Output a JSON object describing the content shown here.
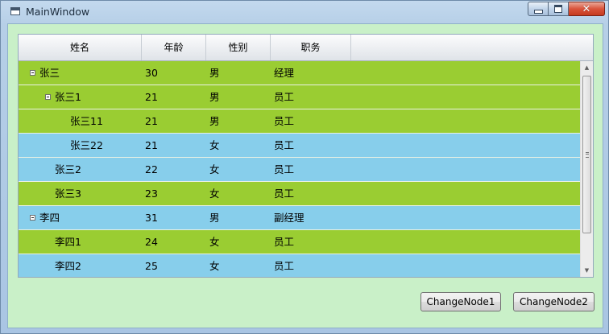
{
  "window": {
    "title": "MainWindow",
    "controls": {
      "minimize": "minimize",
      "maximize": "maximize",
      "close": "✕"
    }
  },
  "colors": {
    "green_row": "#9acd32",
    "blue_row": "#87ceeb",
    "client_bg": "#c9f0c8"
  },
  "grid": {
    "columns": [
      "姓名",
      "年龄",
      "性别",
      "职务"
    ],
    "rows": [
      {
        "name": "张三",
        "age": "30",
        "sex": "男",
        "job": "经理",
        "level": 0,
        "expander": true,
        "color": "green"
      },
      {
        "name": "张三1",
        "age": "21",
        "sex": "男",
        "job": "员工",
        "level": 1,
        "expander": true,
        "color": "green"
      },
      {
        "name": "张三11",
        "age": "21",
        "sex": "男",
        "job": "员工",
        "level": 2,
        "expander": false,
        "color": "green"
      },
      {
        "name": "张三22",
        "age": "21",
        "sex": "女",
        "job": "员工",
        "level": 2,
        "expander": false,
        "color": "blue"
      },
      {
        "name": "张三2",
        "age": "22",
        "sex": "女",
        "job": "员工",
        "level": 1,
        "expander": false,
        "color": "blue"
      },
      {
        "name": "张三3",
        "age": "23",
        "sex": "女",
        "job": "员工",
        "level": 1,
        "expander": false,
        "color": "green"
      },
      {
        "name": "李四",
        "age": "31",
        "sex": "男",
        "job": "副经理",
        "level": 0,
        "expander": true,
        "color": "blue"
      },
      {
        "name": "李四1",
        "age": "24",
        "sex": "女",
        "job": "员工",
        "level": 1,
        "expander": false,
        "color": "green"
      },
      {
        "name": "李四2",
        "age": "25",
        "sex": "女",
        "job": "员工",
        "level": 1,
        "expander": false,
        "color": "blue"
      }
    ]
  },
  "buttons": {
    "change_node1": "ChangeNode1",
    "change_node2": "ChangeNode2"
  }
}
